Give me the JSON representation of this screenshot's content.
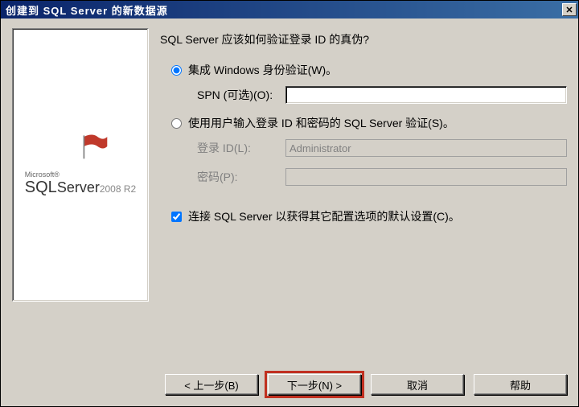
{
  "window": {
    "title": "创建到 SQL Server 的新数据源"
  },
  "logo": {
    "microsoft": "Microsoft®",
    "sql": "SQL",
    "server": "Server",
    "version": "2008 R2"
  },
  "form": {
    "heading": "SQL Server 应该如何验证登录 ID 的真伪?",
    "opt_windows": "集成 Windows 身份验证(W)。",
    "spn_label": "SPN (可选)(O):",
    "spn_value": "",
    "opt_sql": "使用用户输入登录 ID 和密码的 SQL Server 验证(S)。",
    "login_label": "登录 ID(L):",
    "login_value": "Administrator",
    "password_label": "密码(P):",
    "password_value": "",
    "chk_connect": "连接 SQL Server 以获得其它配置选项的默认设置(C)。",
    "auth_selected": "windows",
    "connect_checked": true
  },
  "buttons": {
    "back": "< 上一步(B)",
    "next": "下一步(N) >",
    "cancel": "取消",
    "help": "帮助"
  }
}
